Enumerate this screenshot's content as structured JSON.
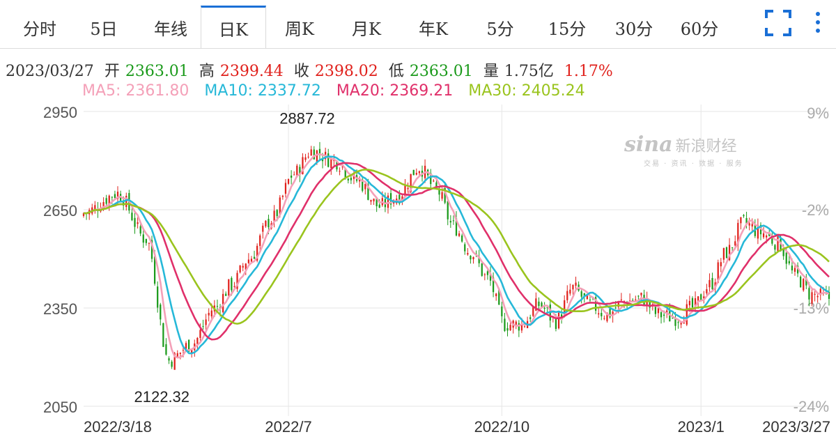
{
  "tabs": [
    {
      "label": "分时"
    },
    {
      "label": "5日"
    },
    {
      "label": "年线"
    },
    {
      "label": "日K"
    },
    {
      "label": "周K"
    },
    {
      "label": "月K"
    },
    {
      "label": "年K"
    },
    {
      "label": "5分"
    },
    {
      "label": "15分"
    },
    {
      "label": "30分"
    },
    {
      "label": "60分"
    }
  ],
  "active_tab": "日K",
  "icons": {
    "expand": "fullscreen-icon",
    "more": "more-vertical-icon"
  },
  "info": {
    "date": "2023/03/27",
    "open_label": "开",
    "open": "2363.01",
    "high_label": "高",
    "high": "2399.44",
    "close_label": "收",
    "close": "2398.02",
    "low_label": "低",
    "low": "2363.01",
    "vol_label": "量",
    "volume": "1.75亿",
    "change": "1.17%"
  },
  "ma_legend": [
    {
      "text": "MA5: 2361.80",
      "color": "#f4a0b8"
    },
    {
      "text": "MA10: 2337.72",
      "color": "#26b8d8"
    },
    {
      "text": "MA20: 2369.21",
      "color": "#e0306a"
    },
    {
      "text": "MA30: 2405.24",
      "color": "#9ac41e"
    }
  ],
  "watermark": {
    "logo": "sina",
    "name": "新浪财经",
    "sub": "交易 · 资讯 · 数据 · 服务"
  },
  "colors": {
    "up": "#e0201b",
    "down": "#1a9a1a",
    "grid": "#e6e6e6",
    "axis_text": "#555555",
    "pct_text": "#aaaaaa"
  },
  "chart_data": {
    "type": "candlestick",
    "y_ticks": [
      2050,
      2350,
      2650,
      2950
    ],
    "ylim": [
      2050,
      2950
    ],
    "pct_ticks": [
      {
        "label": "9%",
        "value": 2950
      },
      {
        "label": "-2%",
        "value": 2650
      },
      {
        "label": "-13%",
        "value": 2350
      },
      {
        "label": "-24%",
        "value": 2050
      }
    ],
    "x_labels": [
      {
        "label": "2022/3/18",
        "index": 0
      },
      {
        "label": "2022/7",
        "index": 72
      },
      {
        "label": "2022/10",
        "index": 147
      },
      {
        "label": "2023/1",
        "index": 217
      },
      {
        "label": "2023/3/27",
        "index": 262
      }
    ],
    "annotations": [
      {
        "text": "2887.72",
        "index": 83,
        "value": 2887.72
      },
      {
        "text": "2122.32",
        "index": 27,
        "value": 2122.32
      }
    ],
    "anchors": [
      [
        0,
        2640
      ],
      [
        12,
        2700
      ],
      [
        22,
        2560
      ],
      [
        30,
        2190
      ],
      [
        38,
        2240
      ],
      [
        46,
        2350
      ],
      [
        52,
        2420
      ],
      [
        58,
        2500
      ],
      [
        66,
        2620
      ],
      [
        74,
        2760
      ],
      [
        80,
        2830
      ],
      [
        88,
        2800
      ],
      [
        96,
        2740
      ],
      [
        104,
        2660
      ],
      [
        110,
        2690
      ],
      [
        118,
        2780
      ],
      [
        124,
        2710
      ],
      [
        130,
        2600
      ],
      [
        136,
        2520
      ],
      [
        142,
        2440
      ],
      [
        148,
        2300
      ],
      [
        154,
        2300
      ],
      [
        160,
        2360
      ],
      [
        166,
        2310
      ],
      [
        172,
        2410
      ],
      [
        178,
        2360
      ],
      [
        184,
        2330
      ],
      [
        190,
        2370
      ],
      [
        196,
        2380
      ],
      [
        202,
        2330
      ],
      [
        208,
        2320
      ],
      [
        214,
        2350
      ],
      [
        220,
        2420
      ],
      [
        226,
        2520
      ],
      [
        232,
        2610
      ],
      [
        238,
        2580
      ],
      [
        244,
        2550
      ],
      [
        250,
        2450
      ],
      [
        256,
        2390
      ],
      [
        262,
        2380
      ]
    ],
    "series": [
      {
        "name": "MA5",
        "period": 5
      },
      {
        "name": "MA10",
        "period": 10
      },
      {
        "name": "MA20",
        "period": 20
      },
      {
        "name": "MA30",
        "period": 30
      }
    ]
  }
}
